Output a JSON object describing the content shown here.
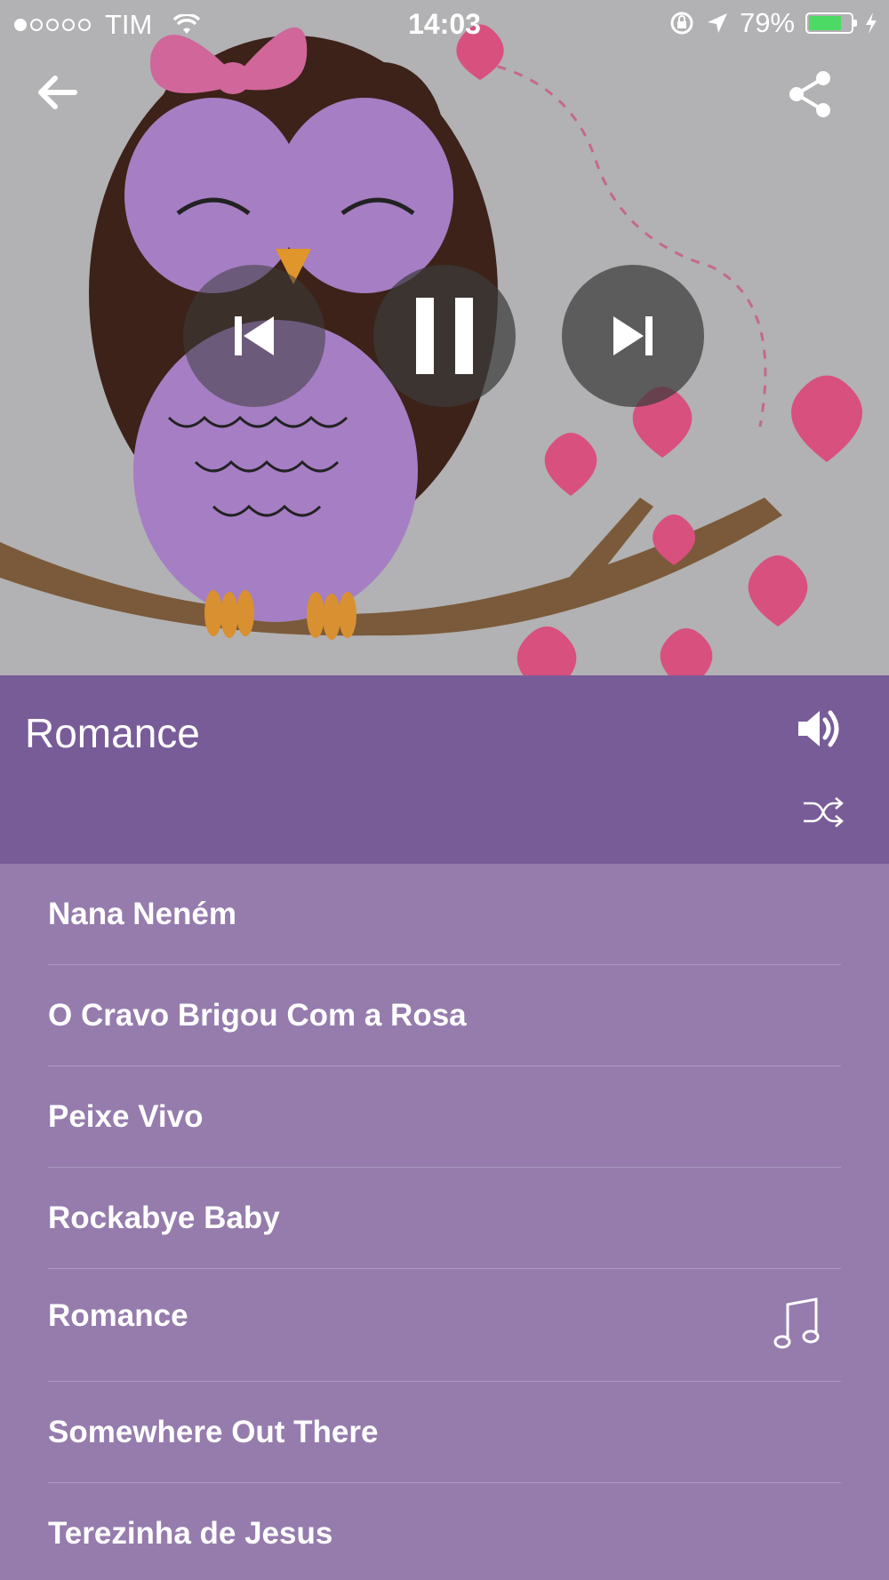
{
  "status_bar": {
    "carrier": "TIM",
    "time": "14:03",
    "battery_percent": "79%",
    "battery_level": 0.79,
    "signal_bars_filled": 1,
    "signal_bars_total": 5
  },
  "album": {
    "title": "Romance"
  },
  "tracks": [
    {
      "title": "Nana Neném",
      "playing": false
    },
    {
      "title": "O Cravo Brigou Com a Rosa",
      "playing": false
    },
    {
      "title": "Peixe Vivo",
      "playing": false
    },
    {
      "title": "Rockabye Baby",
      "playing": false
    },
    {
      "title": "Romance",
      "playing": true
    },
    {
      "title": "Somewhere Out There",
      "playing": false
    },
    {
      "title": "Terezinha de Jesus",
      "playing": false
    }
  ],
  "icons": {
    "back": "arrow-left-icon",
    "share": "share-icon",
    "previous": "skip-previous-icon",
    "pause": "pause-icon",
    "next": "skip-next-icon",
    "volume": "volume-icon",
    "shuffle": "shuffle-icon",
    "now_playing": "music-note-icon"
  },
  "colors": {
    "header_band": "#785C98",
    "list_background": "#957CAD",
    "artwork_background": "#B2B1B3",
    "battery": "#4CD964"
  }
}
